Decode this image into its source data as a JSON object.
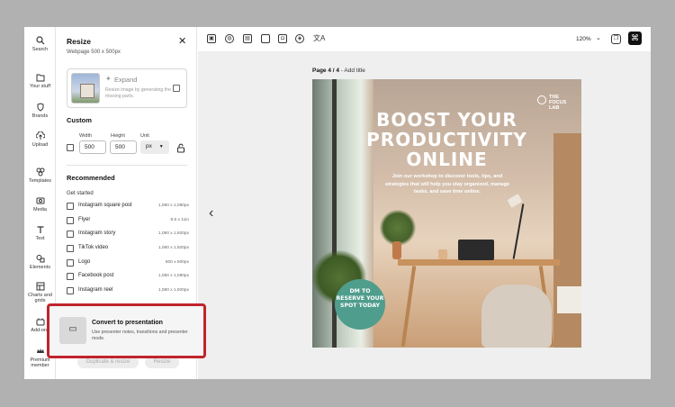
{
  "rail": [
    {
      "label": "Search",
      "icon": "search-icon"
    },
    {
      "label": "Your stuff",
      "icon": "folder-icon"
    },
    {
      "label": "Brands",
      "icon": "brand-icon"
    },
    {
      "label": "Upload",
      "icon": "upload-icon"
    },
    {
      "label": "Templates",
      "icon": "templates-icon"
    },
    {
      "label": "Media",
      "icon": "media-icon"
    },
    {
      "label": "Text",
      "icon": "text-icon"
    },
    {
      "label": "Elements",
      "icon": "elements-icon"
    },
    {
      "label": "Charts and grids",
      "icon": "charts-icon"
    },
    {
      "label": "Add-ons",
      "icon": "addons-icon"
    },
    {
      "label": "Premium member",
      "icon": "premium-icon"
    }
  ],
  "panel": {
    "title": "Resize",
    "close": "✕",
    "subtitle": "Webpage  500 x 500px",
    "expand": {
      "label": "Expand",
      "desc": "Resize image by generating the missing parts."
    },
    "custom": {
      "title": "Custom",
      "width_label": "Width",
      "height_label": "Height",
      "unit_label": "Unit",
      "width": "500",
      "height": "500",
      "unit": "px"
    },
    "recommended_title": "Recommended",
    "get_started": "Get started",
    "presets": [
      {
        "name": "Instagram square post",
        "dim": "1,080 x 1,080px"
      },
      {
        "name": "Flyer",
        "dim": "8.5 x 11in"
      },
      {
        "name": "Instagram story",
        "dim": "1,080 x 1,920px"
      },
      {
        "name": "TikTok video",
        "dim": "1,080 x 1,920px"
      },
      {
        "name": "Logo",
        "dim": "500 x 500px"
      },
      {
        "name": "Facebook post",
        "dim": "1,080 x 1,080px"
      },
      {
        "name": "Instagram reel",
        "dim": "1,080 x 1,920px"
      }
    ],
    "duplicate_btn": "Duplicate & resize",
    "resize_btn": "Resize"
  },
  "convert": {
    "title": "Convert to presentation",
    "desc": "Use presenter notes, transitions and presenter mode."
  },
  "toolbar": {
    "zoom": "120%"
  },
  "canvas": {
    "page_label_bold": "Page 4 / 4",
    "page_label_rest": " - Add title"
  },
  "design": {
    "brand": "THE FOCUS LAB",
    "line1": "BOOST YOUR",
    "line2": "PRODUCTIVITY",
    "line3": "ONLINE",
    "body": "Join our workshop to discover tools, tips, and strategies that will help you stay organized, manage tasks, and save time online.",
    "cta": "DM TO RESERVE YOUR SPOT TODAY"
  }
}
